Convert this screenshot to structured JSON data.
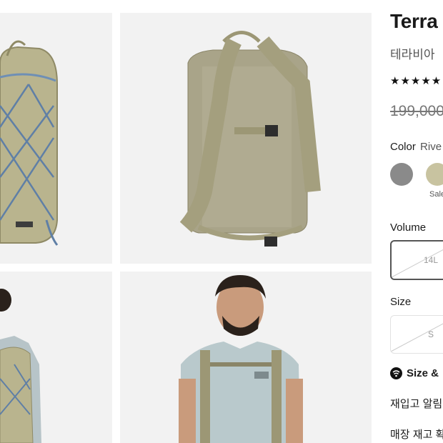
{
  "product": {
    "title": "Terra",
    "subtitle": "테라비아",
    "rating_stars": "★★★★★",
    "price_original": "199,000"
  },
  "color": {
    "label": "Color",
    "selected_value": "Rive",
    "swatches": [
      {
        "name": "gray",
        "hex": "#8a8a8a"
      },
      {
        "name": "river-rock-green",
        "hex": "#c8c3a0"
      }
    ],
    "sale_tag": "Sale"
  },
  "volume": {
    "label": "Volume",
    "options": [
      {
        "label": "14L",
        "available": false,
        "selected": true
      }
    ]
  },
  "size": {
    "label": "Size",
    "options": [
      {
        "label": "S",
        "available": false,
        "selected": false
      }
    ]
  },
  "links": {
    "size_guide": "Size &"
  },
  "actions": {
    "restock_alert": "재입고 알림",
    "store_stock": "매장 재고 확"
  },
  "colors": {
    "tile_bg": "#f2f2f2",
    "pack_khaki": "#b9b48e",
    "cord_blue": "#5f7fa6",
    "text_dark": "#1a1a1a"
  }
}
